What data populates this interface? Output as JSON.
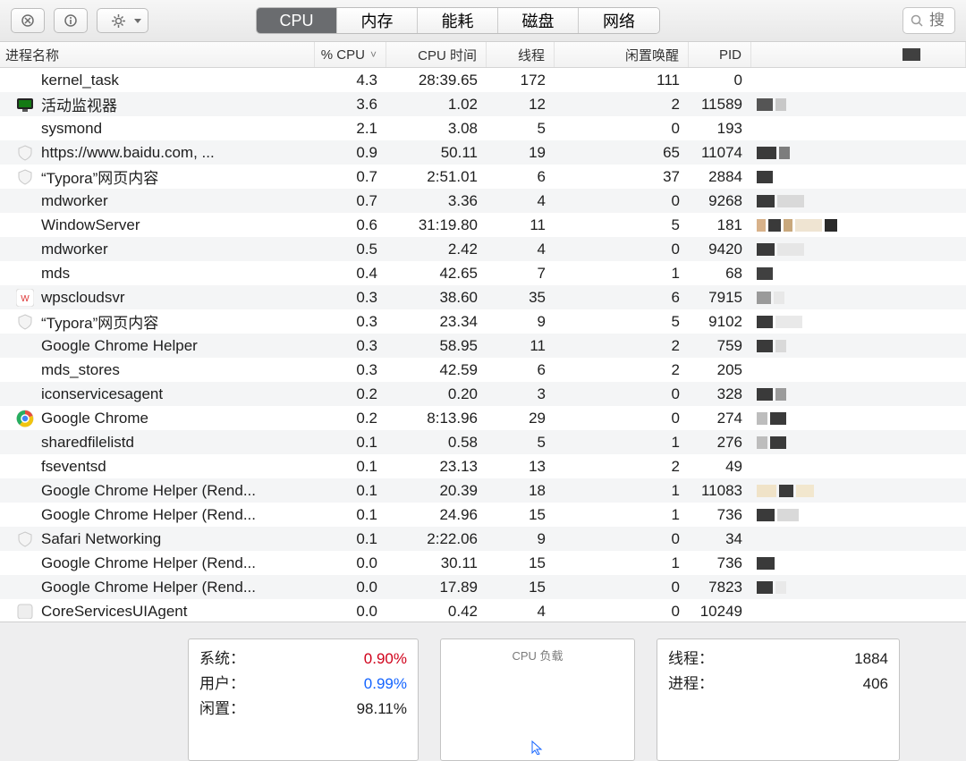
{
  "toolbar": {
    "tabs": [
      "CPU",
      "内存",
      "能耗",
      "磁盘",
      "网络"
    ],
    "active_tab": "CPU",
    "search_placeholder": "搜"
  },
  "columns": {
    "name": "进程名称",
    "cpu": "% CPU",
    "time": "CPU 时间",
    "threads": "线程",
    "wake": "闲置唤醒",
    "pid": "PID"
  },
  "rows": [
    {
      "icon": null,
      "name": "kernel_task",
      "cpu": "4.3",
      "time": "28:39.65",
      "thr": "172",
      "wake": "111",
      "pid": "0",
      "bars": []
    },
    {
      "icon": "monitor",
      "name": "活动监视器",
      "cpu": "3.6",
      "time": "1.02",
      "thr": "12",
      "wake": "2",
      "pid": "11589",
      "bars": [
        [
          "#555",
          18
        ],
        [
          "#c8c8c8",
          12
        ]
      ]
    },
    {
      "icon": null,
      "name": "sysmond",
      "cpu": "2.1",
      "time": "3.08",
      "thr": "5",
      "wake": "0",
      "pid": "193",
      "bars": []
    },
    {
      "icon": "shield",
      "name": "https://www.baidu.com, ...",
      "cpu": "0.9",
      "time": "50.11",
      "thr": "19",
      "wake": "65",
      "pid": "11074",
      "bars": [
        [
          "#3a3a3a",
          22
        ],
        [
          "#7d7d7d",
          12
        ]
      ]
    },
    {
      "icon": "shield",
      "name": "“Typora”网页内容",
      "cpu": "0.7",
      "time": "2:51.01",
      "thr": "6",
      "wake": "37",
      "pid": "2884",
      "bars": [
        [
          "#3a3a3a",
          18
        ]
      ]
    },
    {
      "icon": null,
      "name": "mdworker",
      "cpu": "0.7",
      "time": "3.36",
      "thr": "4",
      "wake": "0",
      "pid": "9268",
      "bars": [
        [
          "#3a3a3a",
          20
        ],
        [
          "#d9d9d9",
          30
        ]
      ]
    },
    {
      "icon": null,
      "name": "WindowServer",
      "cpu": "0.6",
      "time": "31:19.80",
      "thr": "11",
      "wake": "5",
      "pid": "181",
      "bars": [
        [
          "#d8b28a",
          10
        ],
        [
          "#3a3a3a",
          14
        ],
        [
          "#c9a87c",
          10
        ],
        [
          "#efe4d2",
          30
        ],
        [
          "#2a2a2a",
          14
        ]
      ]
    },
    {
      "icon": null,
      "name": "mdworker",
      "cpu": "0.5",
      "time": "2.42",
      "thr": "4",
      "wake": "0",
      "pid": "9420",
      "bars": [
        [
          "#3a3a3a",
          20
        ],
        [
          "#e6e6e6",
          30
        ]
      ]
    },
    {
      "icon": null,
      "name": "mds",
      "cpu": "0.4",
      "time": "42.65",
      "thr": "7",
      "wake": "1",
      "pid": "68",
      "bars": [
        [
          "#404040",
          18
        ]
      ]
    },
    {
      "icon": "wps",
      "name": "wpscloudsvr",
      "cpu": "0.3",
      "time": "38.60",
      "thr": "35",
      "wake": "6",
      "pid": "7915",
      "bars": [
        [
          "#9a9a9a",
          16
        ],
        [
          "#e8e8e8",
          12
        ]
      ]
    },
    {
      "icon": "shield",
      "name": "“Typora”网页内容",
      "cpu": "0.3",
      "time": "23.34",
      "thr": "9",
      "wake": "5",
      "pid": "9102",
      "bars": [
        [
          "#3a3a3a",
          18
        ],
        [
          "#e9e9e9",
          30
        ]
      ]
    },
    {
      "icon": null,
      "name": "Google Chrome Helper",
      "cpu": "0.3",
      "time": "58.95",
      "thr": "11",
      "wake": "2",
      "pid": "759",
      "bars": [
        [
          "#3a3a3a",
          18
        ],
        [
          "#d9d9d9",
          12
        ]
      ]
    },
    {
      "icon": null,
      "name": "mds_stores",
      "cpu": "0.3",
      "time": "42.59",
      "thr": "6",
      "wake": "2",
      "pid": "205",
      "bars": []
    },
    {
      "icon": null,
      "name": "iconservicesagent",
      "cpu": "0.2",
      "time": "0.20",
      "thr": "3",
      "wake": "0",
      "pid": "328",
      "bars": [
        [
          "#3a3a3a",
          18
        ],
        [
          "#9b9b9b",
          12
        ]
      ]
    },
    {
      "icon": "chrome",
      "name": "Google Chrome",
      "cpu": "0.2",
      "time": "8:13.96",
      "thr": "29",
      "wake": "0",
      "pid": "274",
      "bars": [
        [
          "#bdbdbd",
          12
        ],
        [
          "#3a3a3a",
          18
        ]
      ]
    },
    {
      "icon": null,
      "name": "sharedfilelistd",
      "cpu": "0.1",
      "time": "0.58",
      "thr": "5",
      "wake": "1",
      "pid": "276",
      "bars": [
        [
          "#bdbdbd",
          12
        ],
        [
          "#3a3a3a",
          18
        ]
      ]
    },
    {
      "icon": null,
      "name": "fseventsd",
      "cpu": "0.1",
      "time": "23.13",
      "thr": "13",
      "wake": "2",
      "pid": "49",
      "bars": []
    },
    {
      "icon": null,
      "name": "Google Chrome Helper (Rend...",
      "cpu": "0.1",
      "time": "20.39",
      "thr": "18",
      "wake": "1",
      "pid": "11083",
      "bars": [
        [
          "#f0e3c8",
          22
        ],
        [
          "#3a3a3a",
          16
        ],
        [
          "#f2e7ce",
          20
        ]
      ]
    },
    {
      "icon": null,
      "name": "Google Chrome Helper (Rend...",
      "cpu": "0.1",
      "time": "24.96",
      "thr": "15",
      "wake": "1",
      "pid": "736",
      "bars": [
        [
          "#3a3a3a",
          20
        ],
        [
          "#d9d9d9",
          24
        ]
      ]
    },
    {
      "icon": "shield",
      "name": "Safari Networking",
      "cpu": "0.1",
      "time": "2:22.06",
      "thr": "9",
      "wake": "0",
      "pid": "34",
      "bars": []
    },
    {
      "icon": null,
      "name": "Google Chrome Helper (Rend...",
      "cpu": "0.0",
      "time": "30.11",
      "thr": "15",
      "wake": "1",
      "pid": "736",
      "bars": [
        [
          "#3a3a3a",
          20
        ]
      ]
    },
    {
      "icon": null,
      "name": "Google Chrome Helper (Rend...",
      "cpu": "0.0",
      "time": "17.89",
      "thr": "15",
      "wake": "0",
      "pid": "7823",
      "bars": [
        [
          "#3a3a3a",
          18
        ],
        [
          "#e9e9e9",
          12
        ]
      ]
    },
    {
      "icon": "generic",
      "name": "CoreServicesUIAgent",
      "cpu": "0.0",
      "time": "0.42",
      "thr": "4",
      "wake": "0",
      "pid": "10249",
      "bars": []
    }
  ],
  "footer": {
    "left": {
      "system_label": "系统：",
      "system_val": "0.90%",
      "user_label": "用户：",
      "user_val": "0.99%",
      "idle_label": "闲置：",
      "idle_val": "98.11%"
    },
    "mid": {
      "title": "CPU 负载"
    },
    "right": {
      "threads_label": "线程：",
      "threads_val": "1884",
      "procs_label": "进程：",
      "procs_val": "406"
    }
  }
}
